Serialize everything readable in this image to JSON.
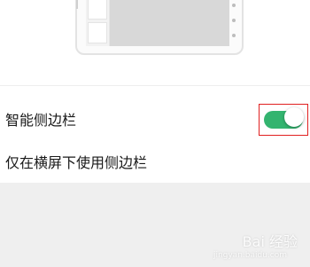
{
  "settings": {
    "items": [
      {
        "label": "智能侧边栏",
        "toggle_on": true
      },
      {
        "label": "仅在横屏下使用侧边栏"
      }
    ]
  },
  "colors": {
    "toggle_on": "#33b46f",
    "highlight": "#e02020",
    "bottom_bg": "#efefef"
  },
  "watermark": {
    "text": "Bai 经验",
    "sub": "jingyan.baidu.com"
  }
}
